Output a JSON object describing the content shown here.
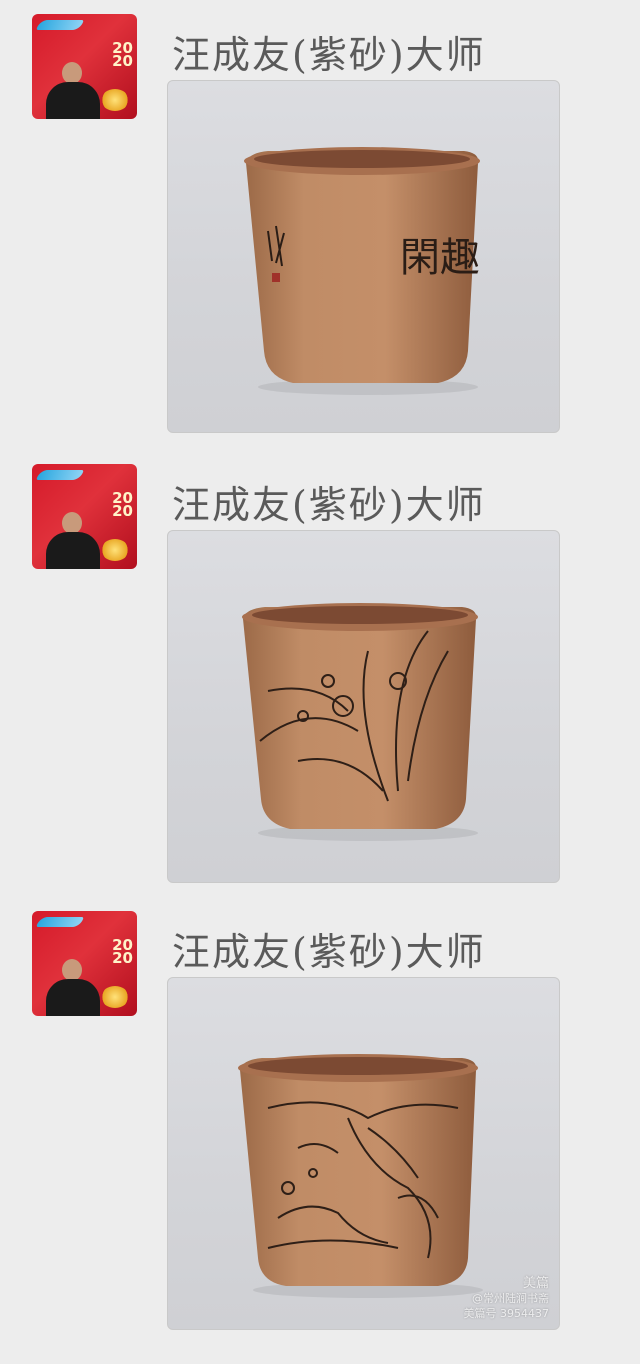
{
  "messages": [
    {
      "sender": "汪成友(紫砂)大师",
      "avatar_text": "20\n20",
      "photo_kind": "calligraphy",
      "inscription": "閑趣"
    },
    {
      "sender": "汪成友(紫砂)大师",
      "avatar_text": "20\n20",
      "photo_kind": "orchid"
    },
    {
      "sender": "汪成友(紫砂)大师",
      "avatar_text": "20\n20",
      "photo_kind": "landscape"
    }
  ],
  "watermark": {
    "brand": "美篇",
    "line1": "@常州陆涧书斋",
    "line2": "美篇号 3954437"
  },
  "colors": {
    "background": "#ededed",
    "clay": "#b7825c",
    "clay_dark": "#9a6244",
    "avatar_red": "#d51a2a"
  }
}
